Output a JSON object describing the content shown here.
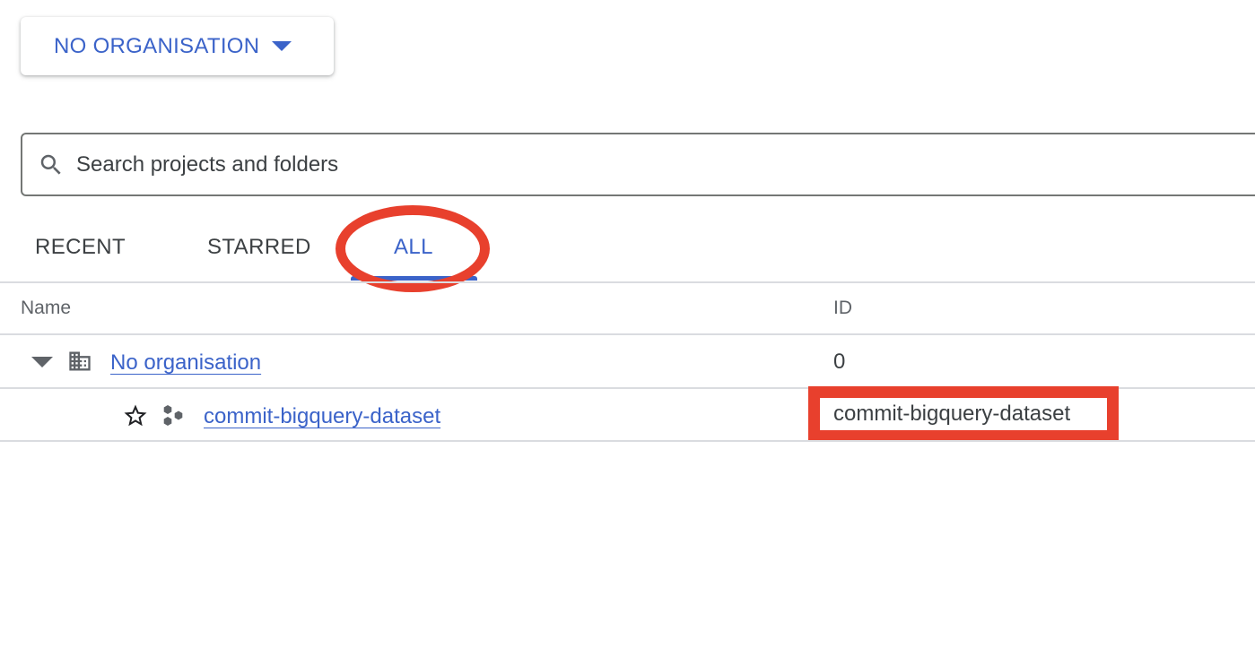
{
  "org_picker": {
    "label": "NO ORGANISATION",
    "icon": "caret-down-icon"
  },
  "search": {
    "placeholder": "Search projects and folders",
    "value": "",
    "icon": "search-icon"
  },
  "tabs": [
    {
      "label": "RECENT",
      "selected": false
    },
    {
      "label": "STARRED",
      "selected": false
    },
    {
      "label": "ALL",
      "selected": true
    }
  ],
  "table": {
    "columns": [
      "Name",
      "ID"
    ],
    "rows": [
      {
        "name": "No organisation",
        "id": "0",
        "type": "organisation",
        "icon": "building-icon",
        "expanded": true
      },
      {
        "name": "commit-bigquery-dataset",
        "id": "commit-bigquery-dataset",
        "type": "project",
        "icon": "project-icon",
        "starred": false
      }
    ]
  },
  "colors": {
    "accent": "#3b63c9",
    "annotation": "#e8402d",
    "text": "#3c4043",
    "muted": "#5f6368",
    "divider": "#dadce0"
  }
}
